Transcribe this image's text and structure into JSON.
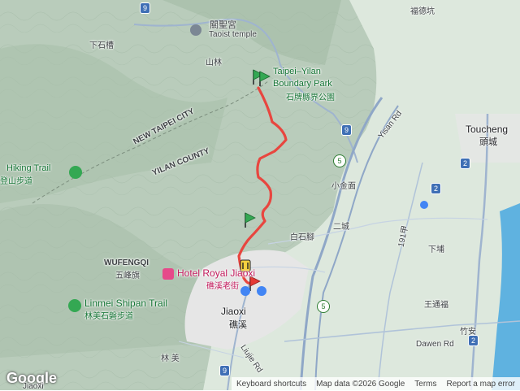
{
  "map": {
    "provider_logo": "Google",
    "colors": {
      "mountain": "#b7cbb9",
      "plain": "#dfe9df",
      "urban": "#ececec",
      "road": "#9fb4cf",
      "highway": "#8fa7c7",
      "trail": "#e8463f",
      "ocean": "#5fb2e0",
      "pin_green": "#34a853",
      "pin_yellow": "#f4d03f",
      "pin_red": "#e53935"
    },
    "labels": {
      "guansheng_temple": "關聖宮",
      "taoist_temple": "Taoist temple",
      "fude_keng": "福德坑",
      "xia_shicao": "下石槽",
      "shanlin": "山林",
      "park_en_1": "Taipei–Yilan",
      "park_en_2": "Boundary Park",
      "park_zh": "石牌縣界公園",
      "new_taipei": "NEW TAIPEI CITY",
      "yilan_county": "YILAN COUNTY",
      "hiking_trail": "Hiking Trail",
      "hiking_trail_zh": "登山步道",
      "toucheng": "Toucheng",
      "toucheng_zh": "頭城",
      "yisan_rd": "Yisan Rd",
      "xiao_jinmian": "小金面",
      "er_cheng": "二城",
      "bai_shi_jiao": "白石腳",
      "xia_pu": "下埔",
      "wufengqi": "WUFENGQI",
      "wufengqi_zh": "五峰旗",
      "hotel_royal": "Hotel Royal Jiaoxi",
      "jiaoxi_old_street": "礁溪老街",
      "linmei_trail": "Linmei Shipan Trail",
      "linmei_trail_zh": "林美石磐步道",
      "jiaoxi": "Jiaoxi",
      "jiaoxi_zh": "礁溪",
      "wang_tong_fu": "王通福",
      "zhu_an": "竹安",
      "dawen_rd": "Dawen Rd",
      "lin_mei": "林 美",
      "liujie_rd": "Liujie Rd",
      "jiaoxi_bottom": "Jiaoxi",
      "r191": "191甲"
    },
    "shields": {
      "r9_top": "9",
      "r9_mid": "9",
      "r9_bottom": "9",
      "r5_a": "5",
      "r5_b": "5",
      "r2": "2",
      "r2a": "2",
      "r2c": "2"
    },
    "footer": {
      "keyboard": "Keyboard shortcuts",
      "data": "Map data ©2026 Google",
      "terms": "Terms",
      "report": "Report a map error"
    }
  }
}
